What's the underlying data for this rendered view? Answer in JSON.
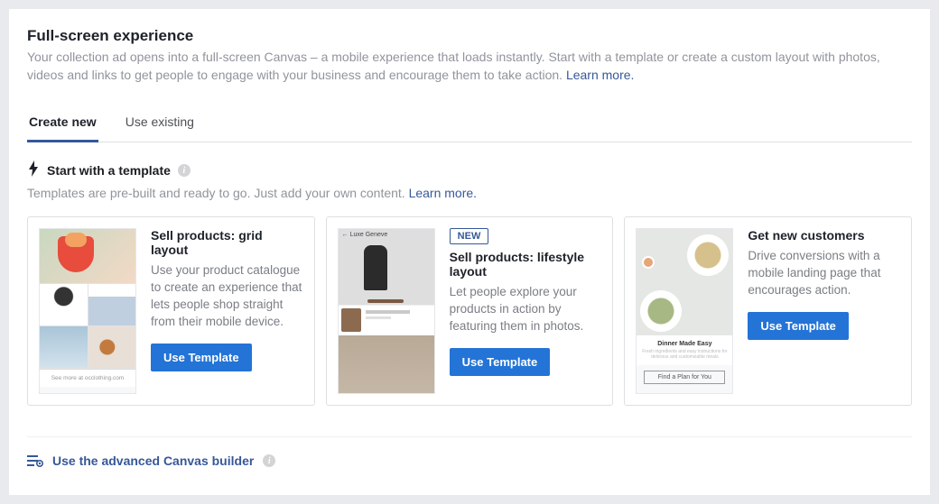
{
  "header": {
    "title": "Full-screen experience",
    "description": "Your collection ad opens into a full-screen Canvas – a mobile experience that loads instantly. Start with a template or create a custom layout with photos, videos and links to get people to engage with your business and encourage them to take action. ",
    "learn_more": "Learn more."
  },
  "tabs": {
    "create": "Create new",
    "existing": "Use existing"
  },
  "template_section": {
    "icon": "bolt-icon",
    "title": "Start with a template",
    "hint": "Templates are pre-built and ready to go. Just add your own content. ",
    "learn_more": "Learn more."
  },
  "cards": [
    {
      "badge": null,
      "title": "Sell products: grid layout",
      "desc": "Use your product catalogue to create an experience that lets people shop straight from their mobile device.",
      "button": "Use Template",
      "thumb": {
        "footer_text": "See more at occlothing.com"
      }
    },
    {
      "badge": "NEW",
      "title": "Sell products: lifestyle layout",
      "desc": "Let people explore your products in action by featuring them in photos.",
      "button": "Use Template",
      "thumb": {
        "header_text": "Luxe Geneve"
      }
    },
    {
      "badge": null,
      "title": "Get new customers",
      "desc": "Drive conversions with a mobile landing page that encourages action.",
      "button": "Use Template",
      "thumb": {
        "label_title": "Dinner Made Easy",
        "label_sub": "Fresh ingredients and easy instructions for delicious and customizable meals",
        "cta": "Find a Plan for You"
      }
    }
  ],
  "advanced": {
    "link": "Use the advanced Canvas builder",
    "icon": "settings-list-icon"
  }
}
